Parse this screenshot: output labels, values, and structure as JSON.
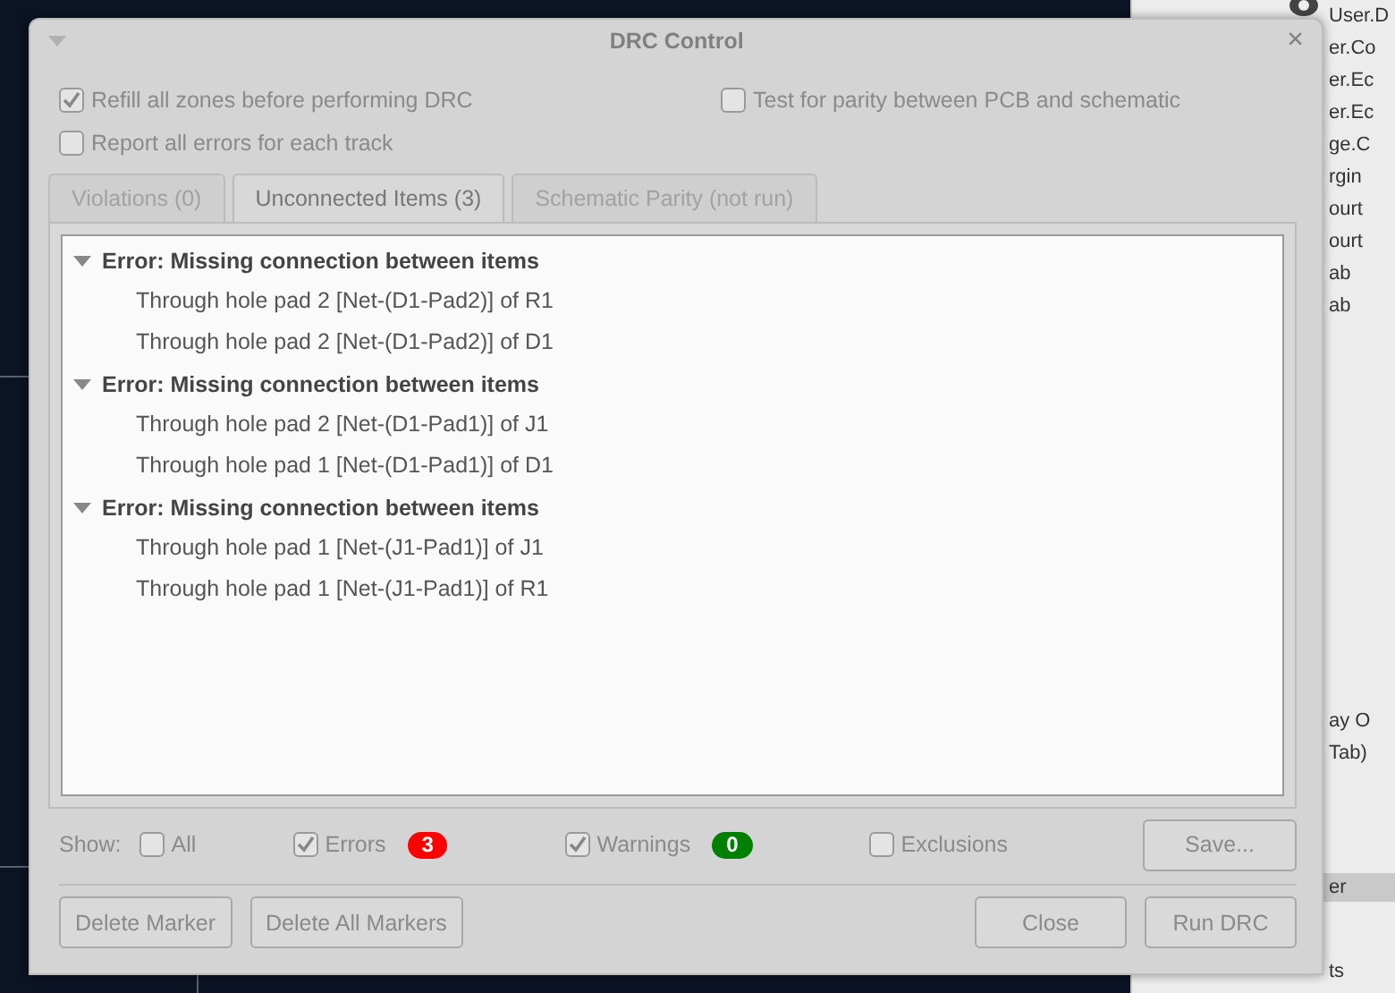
{
  "window": {
    "title": "DRC Control",
    "close": "×"
  },
  "options": [
    {
      "label": "Refill all zones before performing DRC",
      "checked": true
    },
    {
      "label": "Test for parity between PCB and schematic",
      "checked": false
    },
    {
      "label": "Report all errors for each track",
      "checked": false
    }
  ],
  "tabs": [
    {
      "label": "Violations (0)",
      "selected": false
    },
    {
      "label": "Unconnected Items (3)",
      "selected": true
    },
    {
      "label": "Schematic Parity (not run)",
      "selected": false
    }
  ],
  "tree": [
    {
      "label": "Error: Missing connection between items",
      "expanded": true,
      "children": [
        {
          "label": "Through hole pad 2 [Net-(D1-Pad2)] of R1"
        },
        {
          "label": "Through hole pad 2 [Net-(D1-Pad2)] of D1"
        }
      ]
    },
    {
      "label": "Error: Missing connection between items",
      "expanded": true,
      "children": [
        {
          "label": "Through hole pad 2 [Net-(D1-Pad1)] of J1"
        },
        {
          "label": "Through hole pad 1 [Net-(D1-Pad1)] of D1"
        }
      ]
    },
    {
      "label": "Error: Missing connection between items",
      "expanded": true,
      "children": [
        {
          "label": "Through hole pad 1 [Net-(J1-Pad1)] of J1"
        },
        {
          "label": "Through hole pad 1 [Net-(J1-Pad1)] of R1"
        }
      ]
    }
  ],
  "filters": {
    "label": "Show:",
    "items": [
      {
        "label": "All",
        "checked": false
      },
      {
        "label": "Errors",
        "checked": true,
        "count": "3",
        "color": "#ff0000"
      },
      {
        "label": "Warnings",
        "checked": true,
        "count": "0",
        "color": "#008000"
      },
      {
        "label": "Exclusions",
        "checked": false
      }
    ]
  },
  "save_button": "Save...",
  "buttons_left": [
    "Delete Marker",
    "Delete All Markers"
  ],
  "buttons_right": [
    "Close",
    "Run DRC"
  ],
  "background_panel": {
    "items": [
      "User.D",
      "er.Co",
      "er.Ec",
      "er.Ec",
      "ge.C",
      "rgin",
      "ourt",
      "ourt",
      "ab",
      "ab"
    ],
    "lower_items": [
      "ay O",
      "Tab)"
    ],
    "highlighted_item": "er",
    "last_item": "ts"
  }
}
